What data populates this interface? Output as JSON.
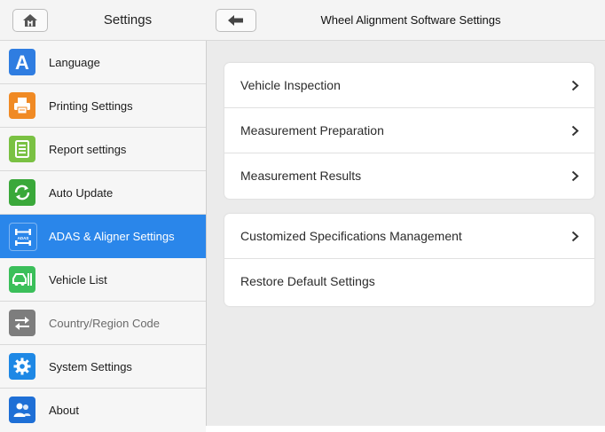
{
  "left_header": {
    "title": "Settings",
    "home_icon": "home-icon"
  },
  "sidebar": {
    "items": [
      {
        "label": "Language",
        "icon": "language-icon",
        "color": "#2f7de1"
      },
      {
        "label": "Printing Settings",
        "icon": "printer-icon",
        "color": "#f08a24"
      },
      {
        "label": "Report settings",
        "icon": "report-icon",
        "color": "#7ac143"
      },
      {
        "label": "Auto Update",
        "icon": "update-icon",
        "color": "#3aa83a"
      },
      {
        "label": "ADAS & Aligner Settings",
        "icon": "adas-icon",
        "color": "#2a86ea",
        "active": true
      },
      {
        "label": "Vehicle List",
        "icon": "vehicle-list-icon",
        "color": "#3bbf5a"
      },
      {
        "label": "Country/Region Code",
        "icon": "swap-icon",
        "color": "#7d7d7d"
      },
      {
        "label": "System Settings",
        "icon": "gear-icon",
        "color": "#1e88e5"
      },
      {
        "label": "About",
        "icon": "about-icon",
        "color": "#1e6fd6"
      }
    ]
  },
  "right_header": {
    "title": "Wheel Alignment Software Settings",
    "back_icon": "back-arrow-icon"
  },
  "groups": [
    {
      "rows": [
        {
          "label": "Vehicle Inspection",
          "chevron": true
        },
        {
          "label": "Measurement Preparation",
          "chevron": true
        },
        {
          "label": "Measurement Results",
          "chevron": true
        }
      ]
    },
    {
      "rows": [
        {
          "label": "Customized Specifications Management",
          "chevron": true
        },
        {
          "label": "Restore Default Settings",
          "chevron": false
        }
      ]
    }
  ],
  "colors": {
    "accent": "#2a86ea",
    "content_bg": "#ebebeb"
  }
}
